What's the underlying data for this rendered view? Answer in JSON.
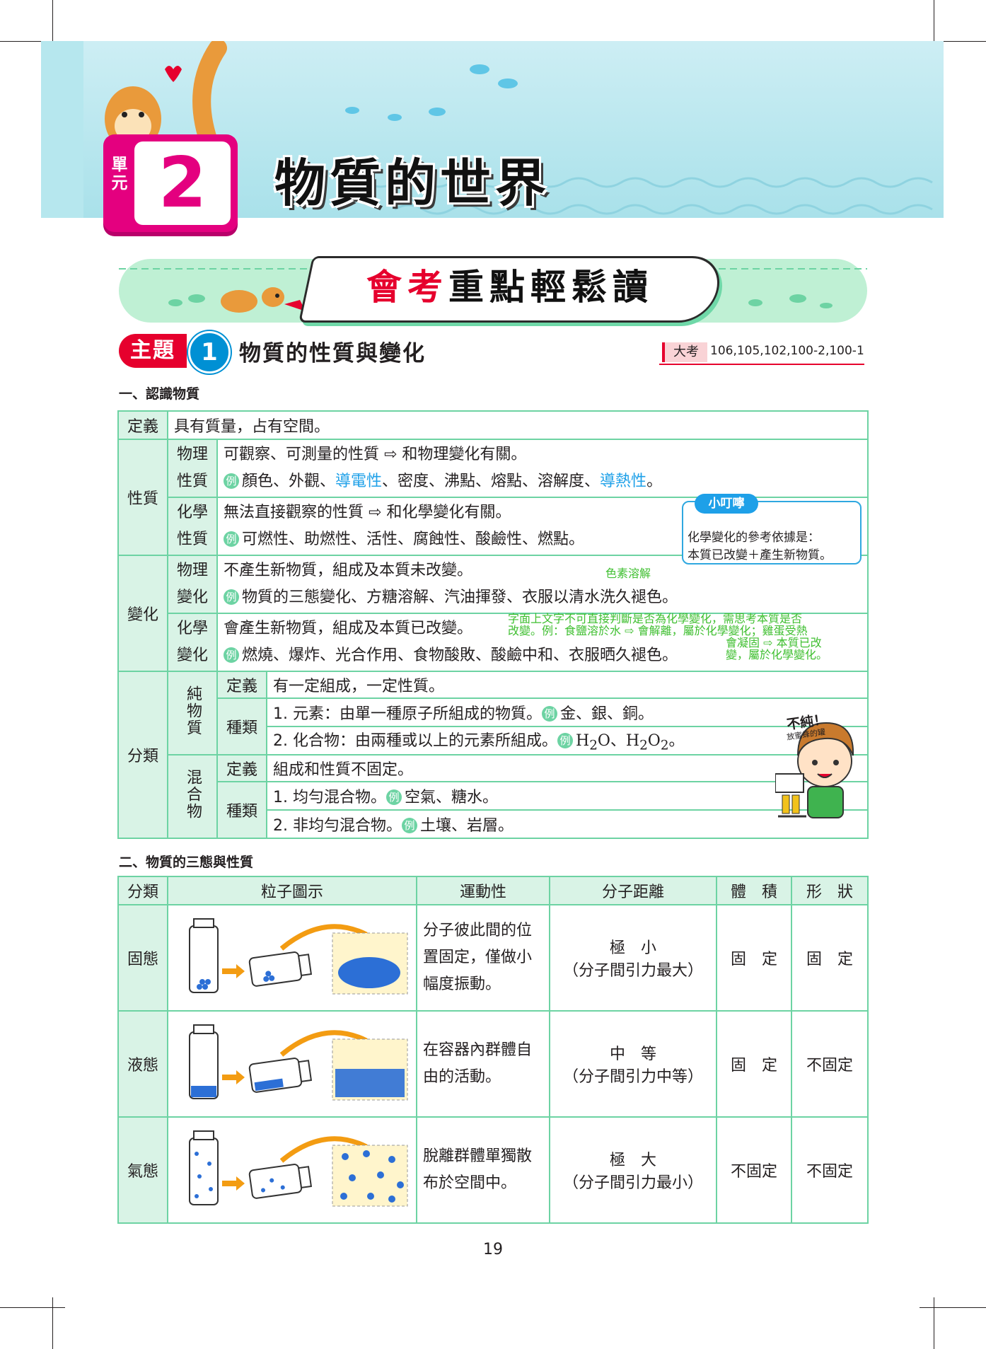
{
  "header": {
    "unit_label": "單元",
    "unit_number": "2",
    "chapter_title": "物質的世界"
  },
  "banner": {
    "title_red": "會考",
    "title_black": "重點輕鬆讀"
  },
  "topic": {
    "tag": "主題",
    "number": "1",
    "title": "物質的性質與變化",
    "exam_tag": "大考",
    "exam_years": "106,105,102,100-2,100-1"
  },
  "section1": {
    "heading": "一、認識物質",
    "definition_label": "定義",
    "definition_text": "具有質量，占有空間。",
    "property_label": "性質",
    "physical_property_label": "物理性質",
    "physical_property_desc": "可觀察、可測量的性質 ⇨ 和物理變化有關。",
    "physical_property_ex": [
      "顏色、外觀、",
      "導電性",
      "、密度、沸點、熔點、溶解度、",
      "導熱性",
      "。"
    ],
    "chemical_property_label": "化學性質",
    "chemical_property_desc": "無法直接觀察的性質 ⇨ 和化學變化有關。",
    "chemical_property_ex": "可燃性、助燃性、活性、腐蝕性、酸鹼性、燃點。",
    "change_label": "變化",
    "physical_change_label": "物理變化",
    "physical_change_desc": "不產生新物質，組成及本質未改變。",
    "physical_change_ex": "物質的三態變化、方糖溶解、汽油揮發、衣服以清水洗久褪色。",
    "chemical_change_label": "化學變化",
    "chemical_change_desc": "會產生新物質，組成及本質已改變。",
    "chemical_change_ex": "燃燒、爆炸、光合作用、食物酸敗、酸鹼中和、衣服晒久褪色。",
    "classification_label": "分類",
    "pure_label": "純物質",
    "pure_def_label": "定義",
    "pure_def": "有一定組成，一定性質。",
    "pure_type_label": "種類",
    "pure_type_1": "1.  元素：由單一種原子所組成的物質。",
    "pure_type_1_ex": "金、銀、銅。",
    "pure_type_2": "2.  化合物：由兩種或以上的元素所組成。",
    "pure_type_2_ex_a": "H",
    "pure_type_2_ex_a_sub": "2",
    "pure_type_2_ex_a_tail": "O、H",
    "pure_type_2_ex_b_sub": "2",
    "pure_type_2_ex_b_mid": "O",
    "pure_type_2_ex_b_sub2": "2",
    "pure_type_2_ex_end": "。",
    "mixture_label": "混合物",
    "mixture_def_label": "定義",
    "mixture_def": "組成和性質不固定。",
    "mixture_type_label": "種類",
    "mixture_type_1": "1.  均勻混合物。",
    "mixture_type_1_ex": "空氣、糖水。",
    "mixture_type_2": "2.  非均勻混合物。",
    "mixture_type_2_ex": "土壤、岩層。",
    "ex_mark": "例"
  },
  "tip": {
    "label": "小叮嚀",
    "line1": "化學變化的參考依據是：",
    "line2": "本質已改變＋產生新物質。"
  },
  "notes": {
    "pigment": "色素溶解",
    "long_1": "字面上文字不可直接判斷是否為化學變化，需思考本質是否",
    "long_2": "改變。例：食鹽溶於水 ⇨ 會解離，屬於化學變化；雞蛋受熱",
    "long_3": "會凝固 ⇨ 本質已改",
    "long_4": "變，屬於化學變化。"
  },
  "mascot": {
    "sign_text": "不純！",
    "sign_sub": "放蜜蜂的罐"
  },
  "section2": {
    "heading": "二、物質的三態與性質",
    "columns": [
      "分類",
      "粒子圖示",
      "運動性",
      "分子距離",
      "體　積",
      "形　狀"
    ],
    "rows": [
      {
        "state": "固態",
        "motion": "分子彼此間的位置固定，僅做小幅度振動。",
        "distance": "極　小",
        "distance_note": "（分子間引力最大）",
        "volume": "固　定",
        "shape": "固　定"
      },
      {
        "state": "液態",
        "motion": "在容器內群體自由的活動。",
        "distance": "中　等",
        "distance_note": "（分子間引力中等）",
        "volume": "固　定",
        "shape": "不固定"
      },
      {
        "state": "氣態",
        "motion": "脫離群體單獨散布於空間中。",
        "distance": "極　大",
        "distance_note": "（分子間引力最小）",
        "volume": "不固定",
        "shape": "不固定"
      }
    ]
  },
  "page_number": "19",
  "colors": {
    "header_bg": "#bfe9f0",
    "magenta": "#e4007f",
    "red": "#e6002d",
    "blue": "#0090d4",
    "table_green": "#6dd3a3",
    "table_fill": "#d9f3e6",
    "note_green": "#3fbf30"
  }
}
